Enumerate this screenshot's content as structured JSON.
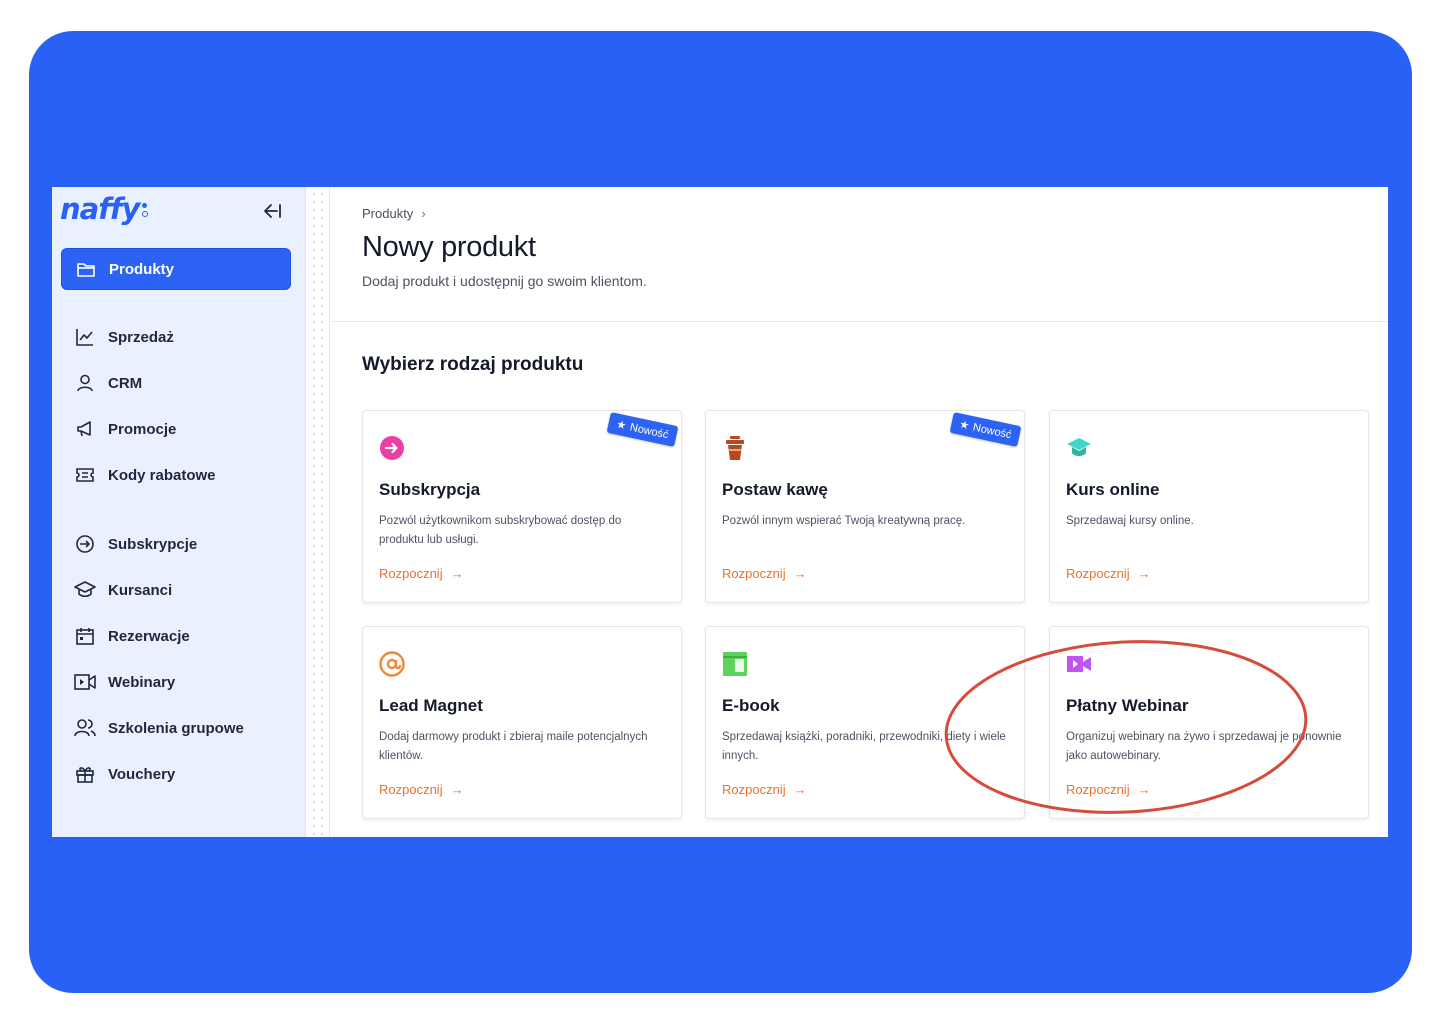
{
  "app": {
    "logo_text": "naffy"
  },
  "sidebar": {
    "items": [
      {
        "label": "Produkty",
        "icon": "folder-icon",
        "active": true
      },
      {
        "label": "Sprzedaż",
        "icon": "chart-line-icon"
      },
      {
        "label": "CRM",
        "icon": "user-icon"
      },
      {
        "label": "Promocje",
        "icon": "megaphone-icon"
      },
      {
        "label": "Kody rabatowe",
        "icon": "ticket-icon"
      },
      {
        "label": "Subskrypcje",
        "icon": "arrow-circle-icon"
      },
      {
        "label": "Kursanci",
        "icon": "graduation-cap-icon"
      },
      {
        "label": "Rezerwacje",
        "icon": "calendar-icon"
      },
      {
        "label": "Webinary",
        "icon": "video-icon"
      },
      {
        "label": "Szkolenia grupowe",
        "icon": "users-icon"
      },
      {
        "label": "Vouchery",
        "icon": "gift-icon"
      }
    ]
  },
  "header": {
    "breadcrumb": "Produkty",
    "breadcrumb_sep": "›",
    "title": "Nowy produkt",
    "subtitle": "Dodaj produkt i udostępnij go swoim klientom."
  },
  "main": {
    "section_title": "Wybierz rodzaj produktu",
    "cta_label": "Rozpocznij",
    "badge_label": "Nowość",
    "cards": [
      {
        "title": "Subskrypcja",
        "desc": "Pozwól użytkownikom subskrybować dostęp do produktu lub usługi.",
        "icon": "subscription-icon",
        "color": "#e83fa3",
        "badge": true
      },
      {
        "title": "Postaw kawę",
        "desc": "Pozwól innym wspierać Twoją kreatywną pracę.",
        "icon": "coffee-cup-icon",
        "color": "#b8481d",
        "badge": true
      },
      {
        "title": "Kurs online",
        "desc": "Sprzedawaj kursy online.",
        "icon": "graduation-cap-icon",
        "color": "#3fd6c8",
        "badge": false
      },
      {
        "title": "Lead Magnet",
        "desc": "Dodaj darmowy produkt i zbieraj maile potencjalnych klientów.",
        "icon": "at-sign-icon",
        "color": "#ee8a3a",
        "badge": false
      },
      {
        "title": "E-book",
        "desc": "Sprzedawaj książki, poradniki, przewodniki, diety i wiele innych.",
        "icon": "ebook-icon",
        "color": "#5fd35c",
        "badge": false
      },
      {
        "title": "Płatny Webinar",
        "desc": "Organizuj webinary na żywo i sprzedawaj je ponownie jako autowebinary.",
        "icon": "video-camera-icon",
        "color": "#c054f0",
        "badge": false
      }
    ]
  },
  "colors": {
    "brand": "#2961f6",
    "accent_cta": "#e8712e",
    "highlight": "#d64b3a"
  }
}
